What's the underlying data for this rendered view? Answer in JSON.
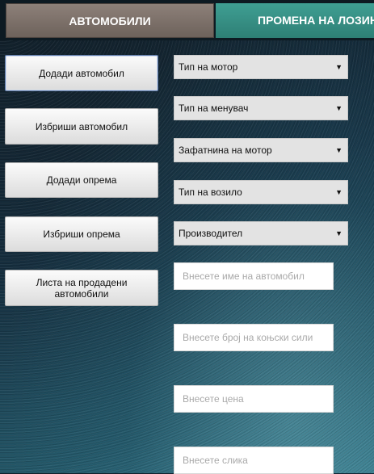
{
  "tabs": [
    {
      "label": "АВТОМОБИЛИ",
      "active": true
    },
    {
      "label": "ПРОМЕНА НА ЛОЗИНКА",
      "active": false
    }
  ],
  "buttons": {
    "add_car": "Додади автомобил",
    "delete_car": "Избриши автомобил",
    "add_equipment": "Додади опрема",
    "delete_equipment": "Избриши опрема",
    "sold_cars_list": "Листа на продадени автомобили"
  },
  "selects": {
    "engine_type": "Тип на мотор",
    "gearbox_type": "Тип на менувач",
    "engine_volume": "Зафатнина на мотор",
    "vehicle_type": "Тип на возило",
    "manufacturer": "Производител"
  },
  "inputs": {
    "car_name": {
      "value": "",
      "placeholder": "Внесете име на автомобил"
    },
    "horsepower": {
      "value": "",
      "placeholder": "Внесете број на коњски сили"
    },
    "price": {
      "value": "",
      "placeholder": "Внесете цена"
    },
    "image": {
      "value": "",
      "placeholder": "Внесете слика"
    }
  },
  "colors": {
    "tab_active": "#7d716a",
    "tab_inactive": "#3a9488",
    "button_face": "#ececec",
    "select_face": "#e3e3e3",
    "background_dark": "#173244",
    "background_light": "#3a8293"
  }
}
